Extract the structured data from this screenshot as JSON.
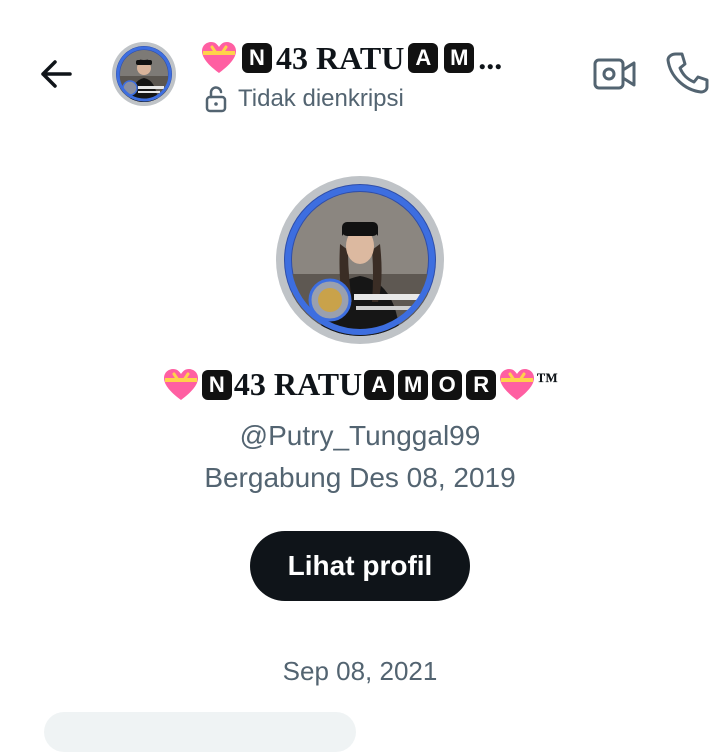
{
  "header": {
    "name_parts": [
      "N",
      "43 RATU ",
      "A",
      "M",
      "..."
    ],
    "encryption_status": "Tidak dienkripsi",
    "icons": {
      "back": "arrow-left-icon",
      "lock": "unlock-icon",
      "video": "video-call-icon",
      "phone": "phone-call-icon"
    }
  },
  "profile": {
    "name_parts": [
      "N",
      "43 RATU ",
      "A",
      "M",
      "O",
      "R",
      "™"
    ],
    "handle": "@Putry_Tunggal99",
    "joined": "Bergabung Des 08, 2019",
    "view_profile_label": "Lihat profil"
  },
  "conversation": {
    "date_separator": "Sep 08, 2021"
  },
  "colors": {
    "text_primary": "#0f1419",
    "text_secondary": "#536471",
    "button_bg": "#0f1419",
    "avatar_ring": "#3d6ee0",
    "heart_pink": "#ff5fa2",
    "heart_ribbon": "#ffd24a"
  }
}
